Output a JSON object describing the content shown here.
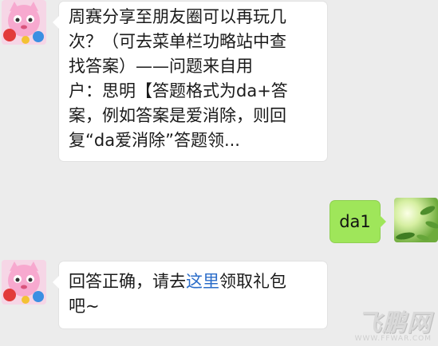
{
  "messages": [
    {
      "side": "left",
      "lines": [
        "周赛分享至朋友圈可以再玩几",
        "次？（可去菜单栏功略站中查",
        "找答案）——问题来自用",
        "户：思明【答题格式为da+答",
        "案，例如答案是爱消除，则回",
        "复“da爱消除”答题领..."
      ]
    },
    {
      "side": "right",
      "text": "da1"
    },
    {
      "side": "left",
      "before_link": "回答正确，请去",
      "link": "这里",
      "after_link": "领取礼包",
      "line2": "吧~"
    }
  ],
  "watermark": {
    "main": "飞鹏网",
    "sub": "WWW.FFWAR.COM"
  },
  "colors": {
    "background": "#ececec",
    "bubble_white": "#ffffff",
    "bubble_green": "#9fe65a",
    "link": "#2a6cc9"
  },
  "icons": {
    "bot_avatar": "pink-cat-avatar-icon",
    "user_avatar": "green-nature-avatar-icon"
  }
}
